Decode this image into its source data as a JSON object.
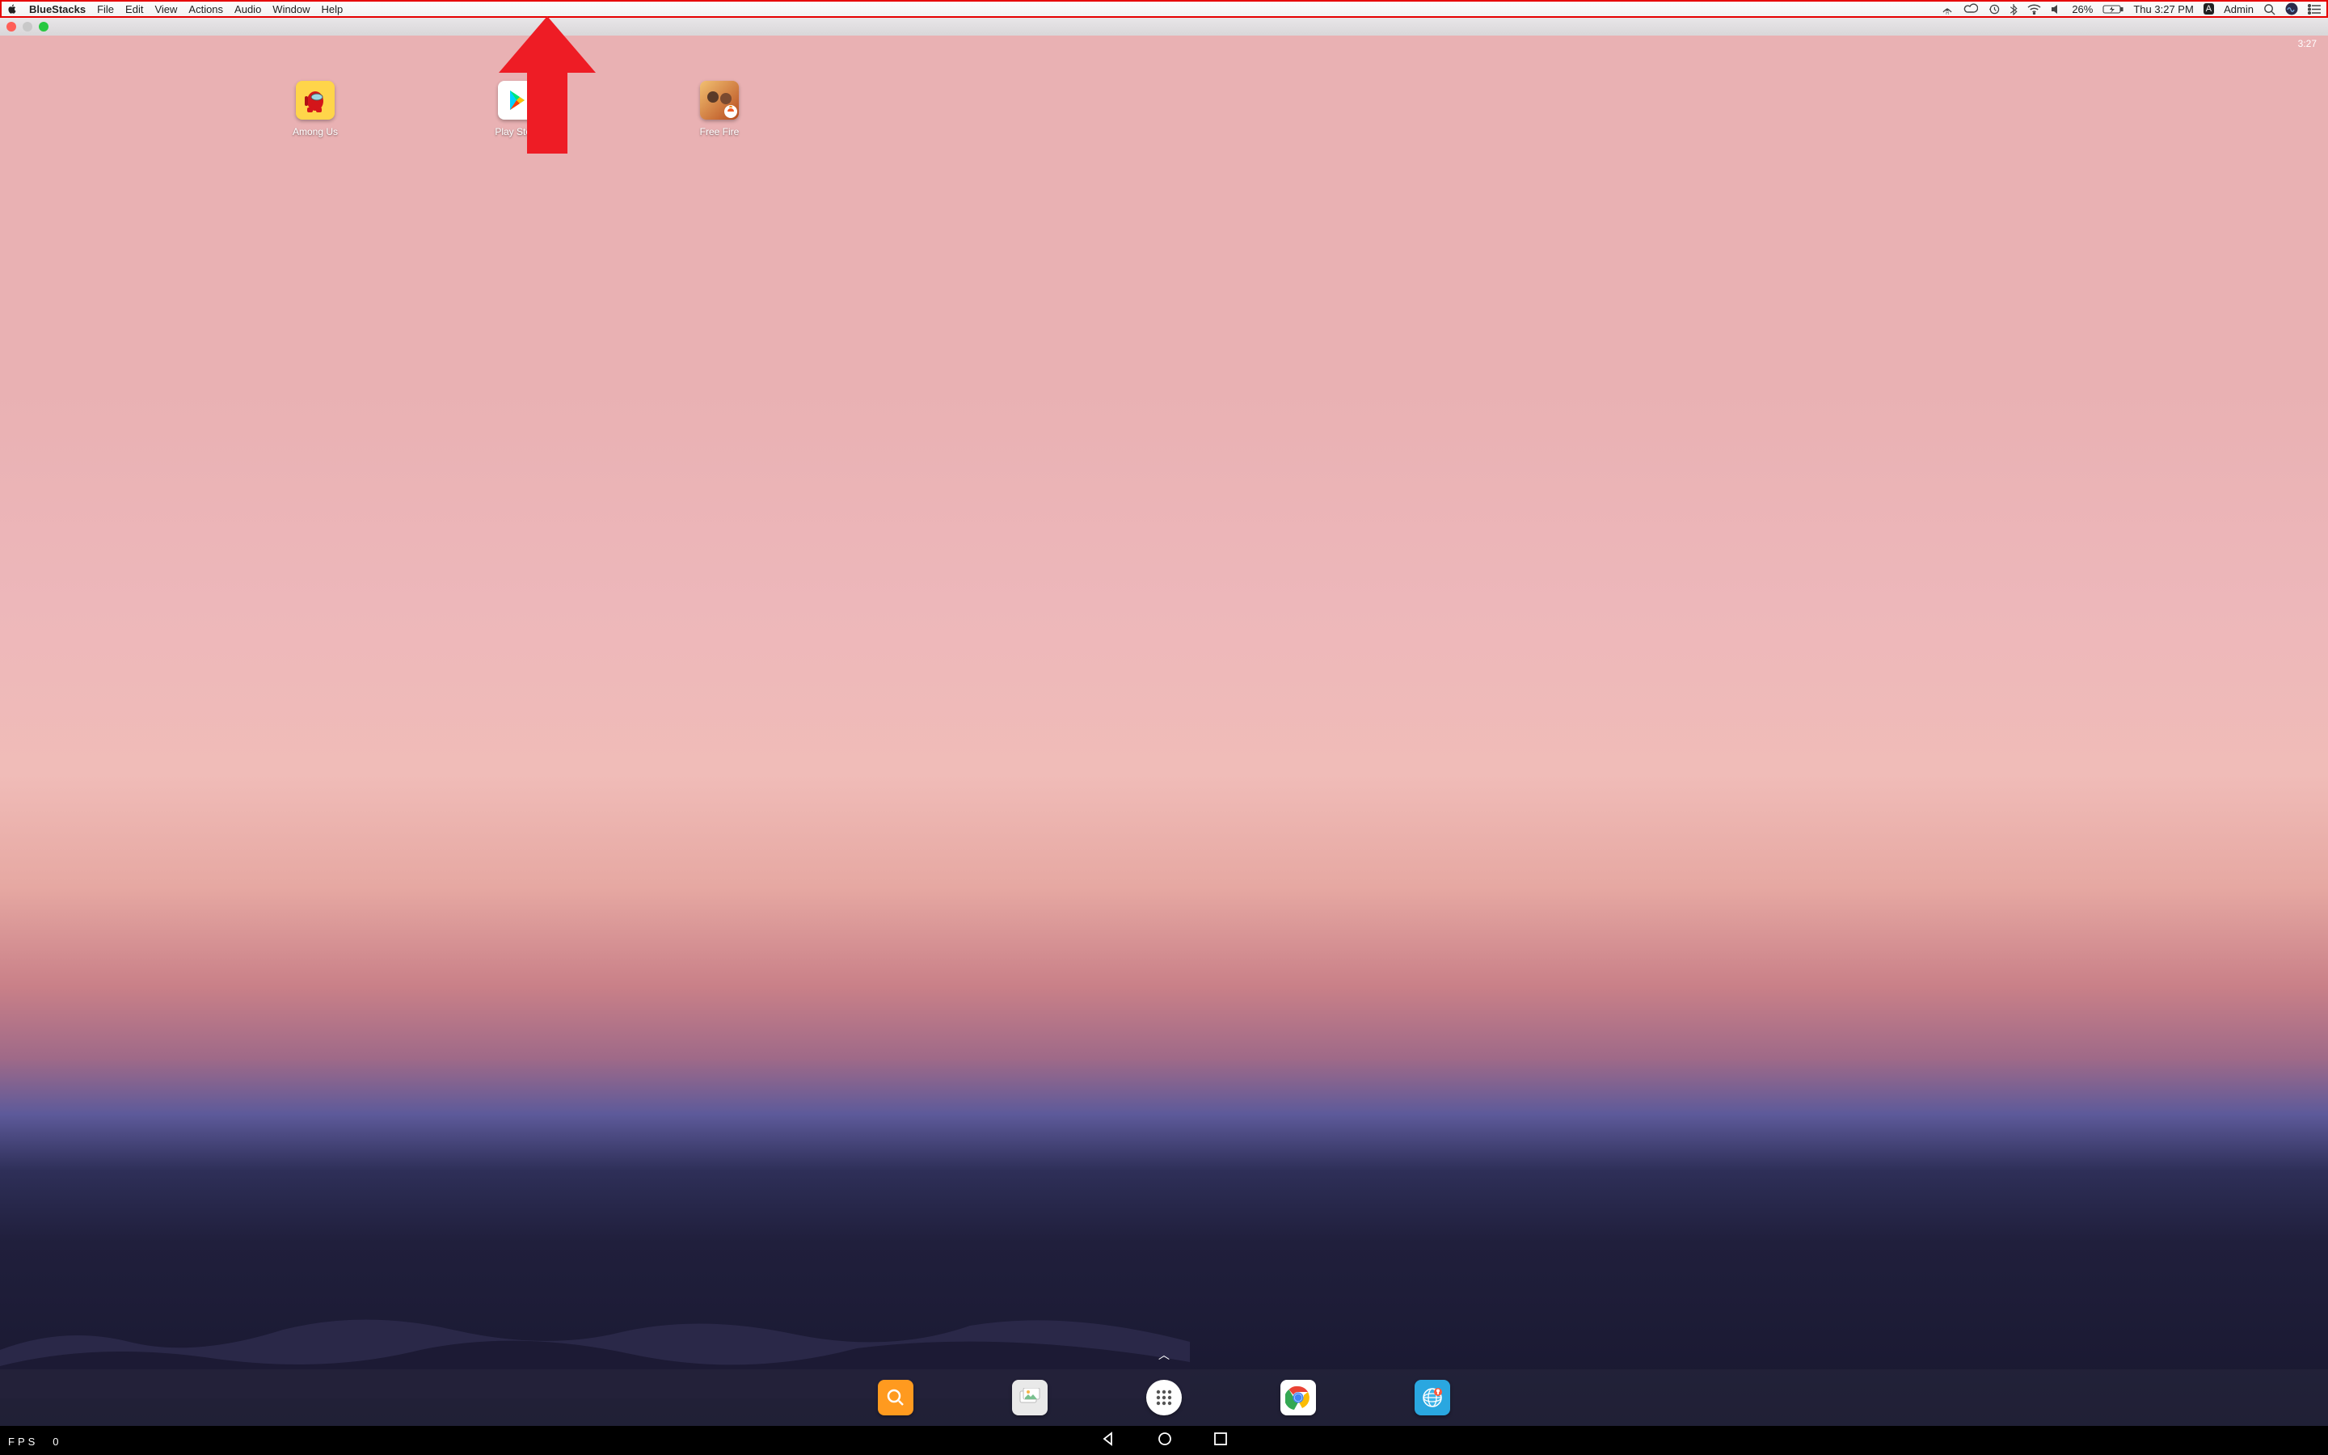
{
  "menubar": {
    "app_name": "BlueStacks",
    "items": [
      "File",
      "Edit",
      "View",
      "Actions",
      "Audio",
      "Window",
      "Help"
    ],
    "battery": "26%",
    "clock": "Thu 3:27 PM",
    "keyboard_badge": "A",
    "user": "Admin"
  },
  "android_status": {
    "time": "3:27"
  },
  "home_apps": [
    {
      "label": "Among Us",
      "bg": "#ffd54a"
    },
    {
      "label": "Play Store",
      "bg": "#ffffff"
    },
    {
      "label": "Free Fire",
      "bg": "#f0e0c0"
    }
  ],
  "dock_apps": [
    {
      "name": "search",
      "bg": "#ff9a1f"
    },
    {
      "name": "gallery",
      "bg": "#e6e6e6"
    },
    {
      "name": "app-drawer",
      "bg": "#ffffff"
    },
    {
      "name": "chrome",
      "bg": "#ffffff"
    },
    {
      "name": "browser",
      "bg": "#2aa7e0"
    }
  ],
  "fps": {
    "label": "FPS",
    "value": "0"
  }
}
